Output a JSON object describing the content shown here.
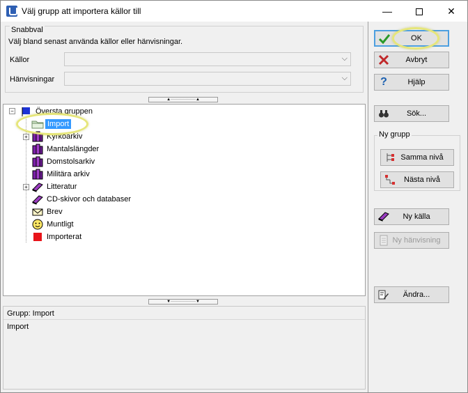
{
  "window": {
    "title": "Välj grupp att importera källor till",
    "min_glyph": "—",
    "close_glyph": "✕"
  },
  "snabbval": {
    "legend": "Snabbval",
    "description": "Välj bland senast använda källor eller hänvisningar.",
    "kallor_label": "Källor",
    "kallor_value": "",
    "hanvisningar_label": "Hänvisningar",
    "hanvisningar_value": ""
  },
  "splitter_glyph": "▲··················▲",
  "splitter_glyph_down": "▼··················▼",
  "tree": {
    "root": {
      "label": "Översta gruppen",
      "icon": "blue-flag-icon"
    },
    "items": [
      {
        "label": "Import",
        "icon": "folder-icon",
        "selected": true,
        "expander": ""
      },
      {
        "label": "Kyrkoarkiv",
        "icon": "books-icon",
        "expander": "+"
      },
      {
        "label": "Mantalslängder",
        "icon": "books-icon",
        "expander": ""
      },
      {
        "label": "Domstolsarkiv",
        "icon": "books-icon",
        "expander": ""
      },
      {
        "label": "Militära arkiv",
        "icon": "books-icon",
        "expander": ""
      },
      {
        "label": "Litteratur",
        "icon": "book-icon",
        "expander": "+"
      },
      {
        "label": "CD-skivor och databaser",
        "icon": "book-icon",
        "expander": ""
      },
      {
        "label": "Brev",
        "icon": "envelope-icon",
        "expander": ""
      },
      {
        "label": "Muntligt",
        "icon": "smiley-icon",
        "expander": ""
      },
      {
        "label": "Importerat",
        "icon": "red-square-icon",
        "expander": ""
      }
    ]
  },
  "grupp": {
    "label": "Grupp: Import",
    "value": "Import"
  },
  "buttons": {
    "ok": "OK",
    "avbryt": "Avbryt",
    "hjalp": "Hjälp",
    "sok": "Sök...",
    "ny_grupp_legend": "Ny grupp",
    "samma_niva": "Samma nivå",
    "nasta_niva": "Nästa nivå",
    "ny_kalla": "Ny källa",
    "ny_hanvisning": "Ny hänvisning",
    "andra": "Ändra..."
  },
  "colors": {
    "selection": "#3399ff",
    "highlight_ring": "#e6e67a",
    "ok_check": "#2a9a2a",
    "cancel_x": "#c0282a",
    "help_q": "#1a5fb0"
  }
}
